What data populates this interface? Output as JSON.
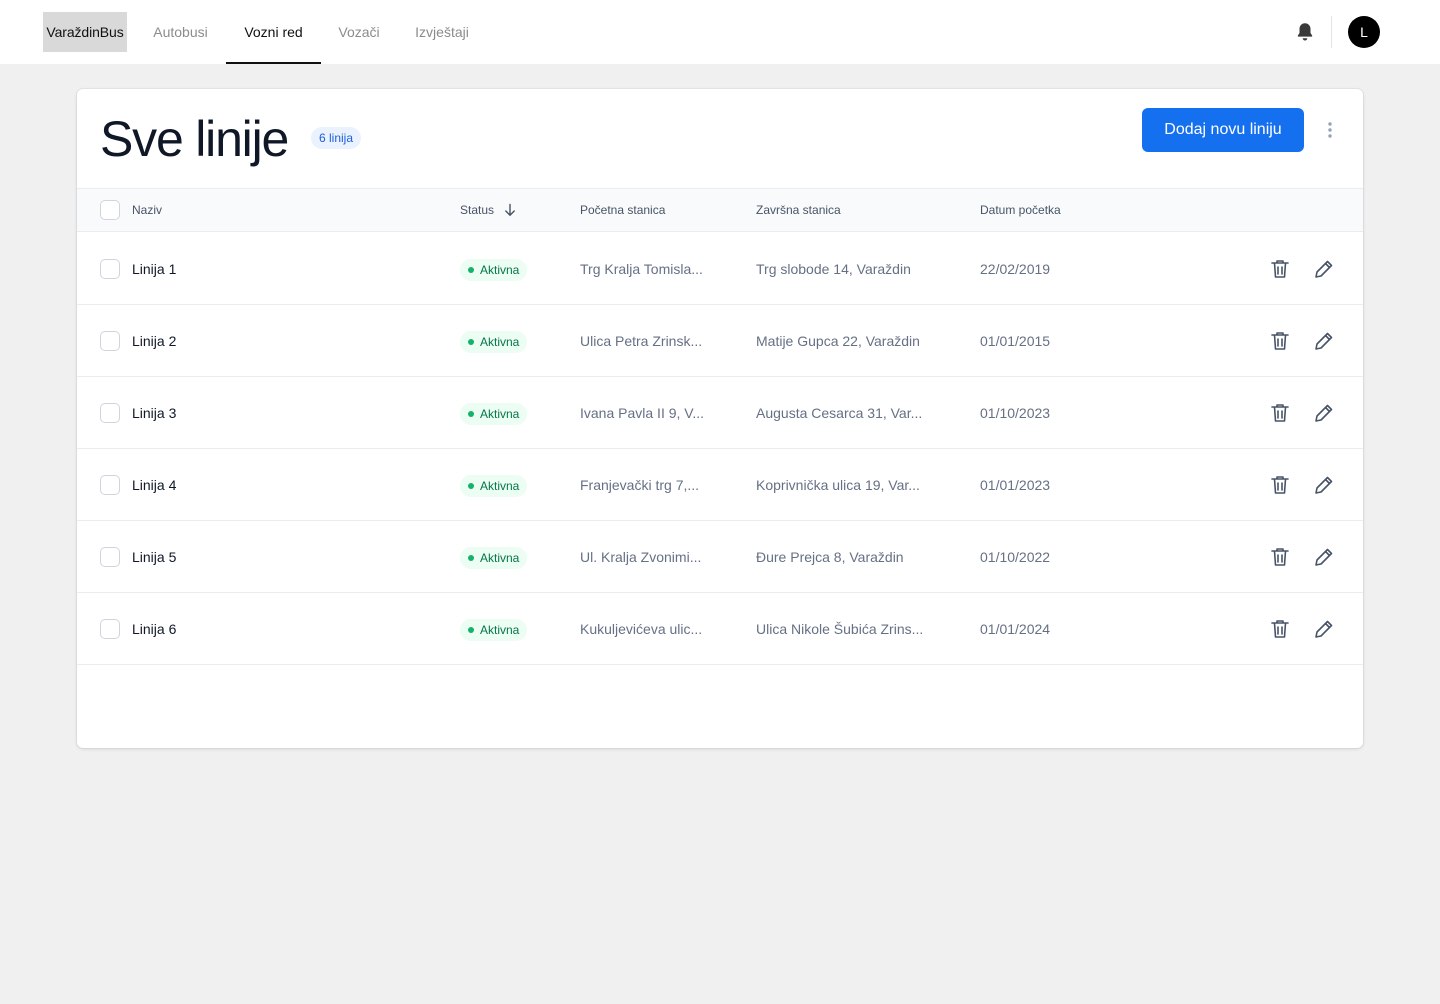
{
  "nav": {
    "brand": "VaraždinBus",
    "links": [
      {
        "label": "Autobusi",
        "active": false
      },
      {
        "label": "Vozni red",
        "active": true
      },
      {
        "label": "Vozači",
        "active": false
      },
      {
        "label": "Izvještaji",
        "active": false
      }
    ],
    "avatar_initial": "L"
  },
  "page": {
    "title": "Sve linije",
    "count_badge": "6 linija",
    "add_button": "Dodaj novu liniju"
  },
  "table": {
    "columns": {
      "name": "Naziv",
      "status": "Status",
      "start": "Početna stanica",
      "end": "Završna stanica",
      "date": "Datum početka"
    },
    "rows": [
      {
        "name": "Linija 1",
        "status": "Aktivna",
        "start": "Trg Kralja Tomisla...",
        "end": "Trg slobode 14, Varaždin",
        "date": "22/02/2019"
      },
      {
        "name": "Linija 2",
        "status": "Aktivna",
        "start": "Ulica Petra Zrinsk...",
        "end": "Matije Gupca 22, Varaždin",
        "date": "01/01/2015"
      },
      {
        "name": "Linija 3",
        "status": "Aktivna",
        "start": "Ivana Pavla II 9, V...",
        "end": "Augusta Cesarca 31, Var...",
        "date": "01/10/2023"
      },
      {
        "name": "Linija 4",
        "status": "Aktivna",
        "start": "Franjevački trg 7,...",
        "end": "Koprivnička ulica 19, Var...",
        "date": "01/01/2023"
      },
      {
        "name": "Linija 5",
        "status": "Aktivna",
        "start": "Ul. Kralja Zvonimi...",
        "end": "Đure Prejca 8, Varaždin",
        "date": "01/10/2022"
      },
      {
        "name": "Linija 6",
        "status": "Aktivna",
        "start": "Kukuljevićeva ulic...",
        "end": "Ulica Nikole Šubića Zrins...",
        "date": "01/01/2024"
      }
    ]
  },
  "colors": {
    "primary": "#1570ef",
    "status_active_bg": "#ecfdf3",
    "status_active_text": "#067647",
    "page_bg": "#f0f0f0"
  },
  "icons": {
    "notifications": "bell-icon",
    "more": "more-vertical-icon",
    "sort": "arrow-down-icon",
    "delete": "trash-icon",
    "edit": "pencil-icon"
  }
}
